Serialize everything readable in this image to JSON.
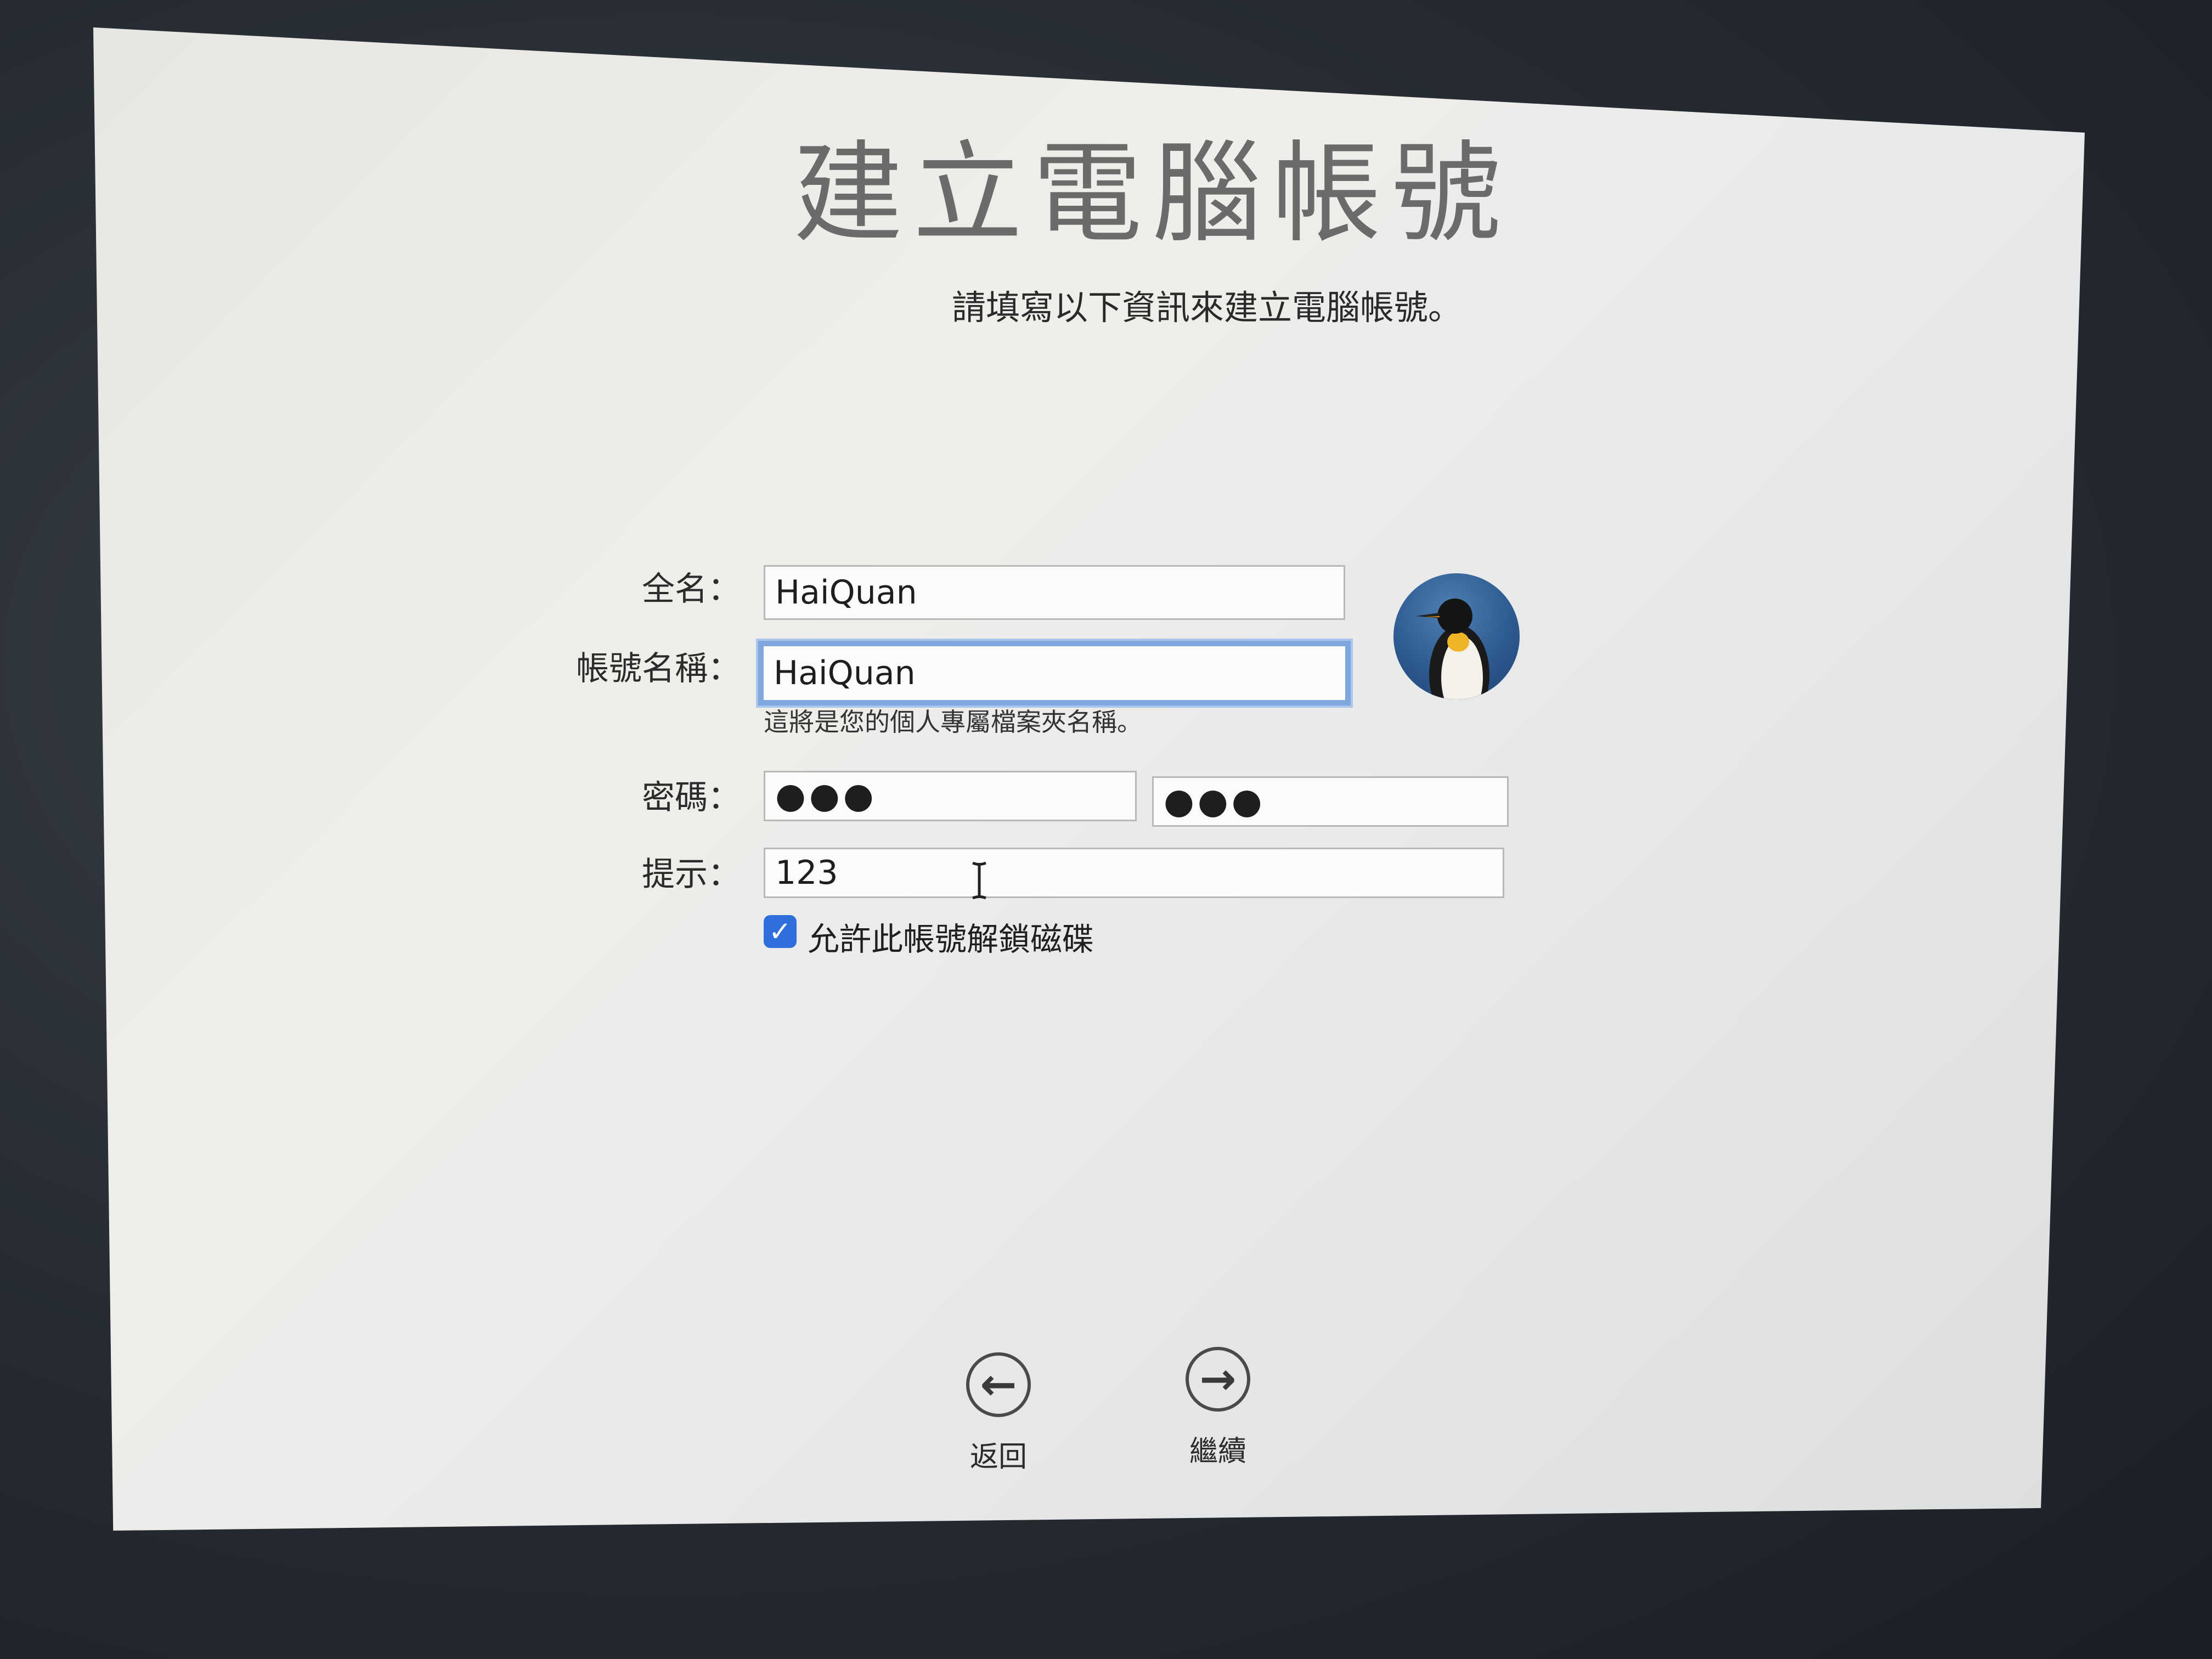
{
  "title": "建立電腦帳號",
  "subtitle": "請填寫以下資訊來建立電腦帳號。",
  "form": {
    "full_name": {
      "label": "全名：",
      "value": "HaiQuan"
    },
    "account_name": {
      "label": "帳號名稱：",
      "value": "HaiQuan",
      "note": "這將是您的個人專屬檔案夾名稱。"
    },
    "password": {
      "label": "密碼：",
      "value": "●●●",
      "verify_value": "●●●"
    },
    "hint": {
      "label": "提示：",
      "value": "123"
    },
    "allow_unlock": {
      "label": "允許此帳號解鎖磁碟",
      "checked": true
    }
  },
  "avatar": {
    "icon": "penguin-avatar-icon"
  },
  "nav": {
    "back_label": "返回",
    "continue_label": "繼續"
  },
  "colors": {
    "accent": "#2f6fdb",
    "focus_ring": "#7fa7de",
    "title": "#6b6b6b"
  }
}
